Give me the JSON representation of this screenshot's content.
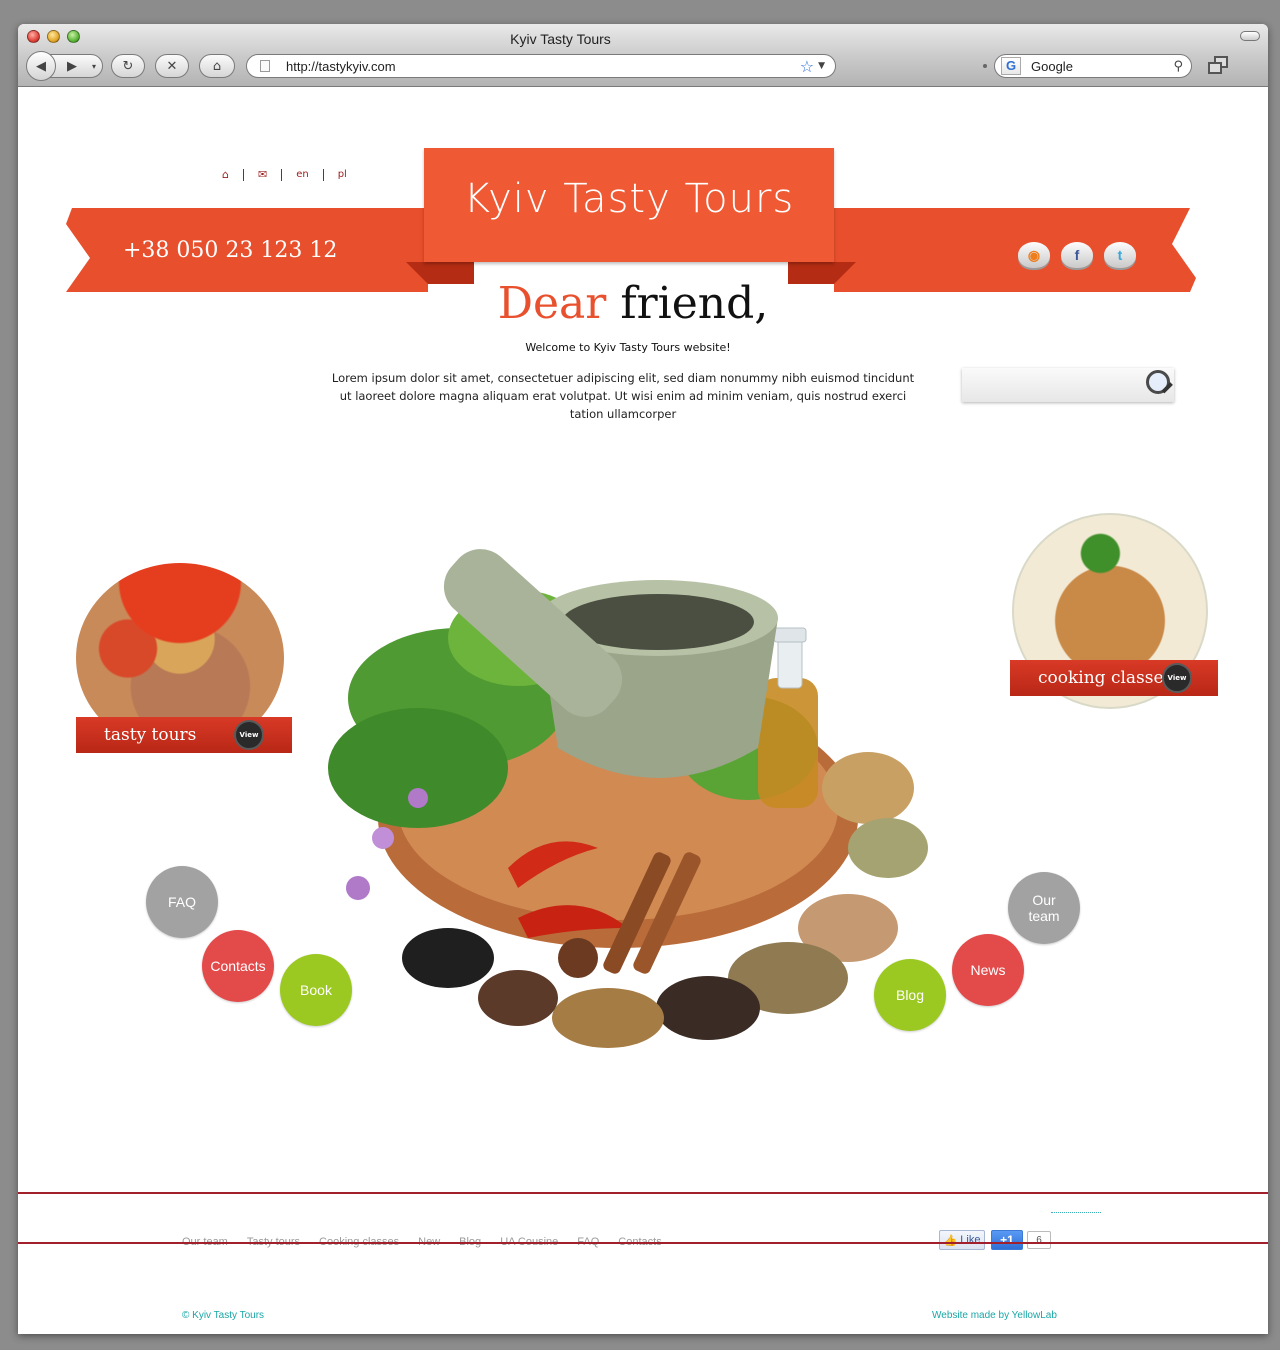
{
  "browser": {
    "window_title": "Kyiv Tasty Tours",
    "url": "http://tastykyiv.com",
    "search_engine": "Google",
    "search_icon_letter": "G"
  },
  "header": {
    "top_links": [
      "en",
      "pl"
    ],
    "phone": "+38 050 23 123 12",
    "logo": "Kyiv Tasty Tours",
    "social_icons": [
      "rss-icon",
      "facebook-icon",
      "twitter-icon"
    ],
    "social_letters": {
      "rss": "◉",
      "facebook": "f",
      "twitter": "t"
    }
  },
  "intro": {
    "greeting_accent": "Dear",
    "greeting_rest": "friend,",
    "welcome": "Welcome to Kyiv Tasty Tours website!",
    "body": "Lorem ipsum dolor sit amet, consectetuer adipiscing elit, sed diam nonummy nibh euismod tincidunt ut laoreet dolore magna aliquam erat volutpat. Ut wisi enim ad minim veniam, quis nostrud exerci tation ullamcorper"
  },
  "features": {
    "tours": {
      "label": "tasty tours",
      "button": "View"
    },
    "cooking": {
      "label": "cooking classes",
      "button": "View"
    }
  },
  "nav_bubbles": {
    "faq": "FAQ",
    "contacts": "Contacts",
    "book": "Book",
    "our_team": "Our team",
    "news": "News",
    "blog": "Blog"
  },
  "footer": {
    "nav": [
      "Our team",
      "Tasty tours",
      "Cooking classes",
      "New",
      "Blog",
      "UA Cousine",
      "FAQ",
      "Contacts"
    ],
    "like": "Like",
    "plus_one": "+1",
    "plus_count": "6",
    "copyright": "© Kyiv Tasty Tours",
    "made_by": "Website made by YellowLab"
  },
  "colors": {
    "accent_orange": "#ef5a35",
    "ribbon_red": "#e84f2d",
    "footer_line": "#a2202b",
    "bubble_gray": "#a2a2a2",
    "bubble_red": "#e34a4a",
    "bubble_green": "#9bc922",
    "link_teal": "#1aa6a6"
  }
}
